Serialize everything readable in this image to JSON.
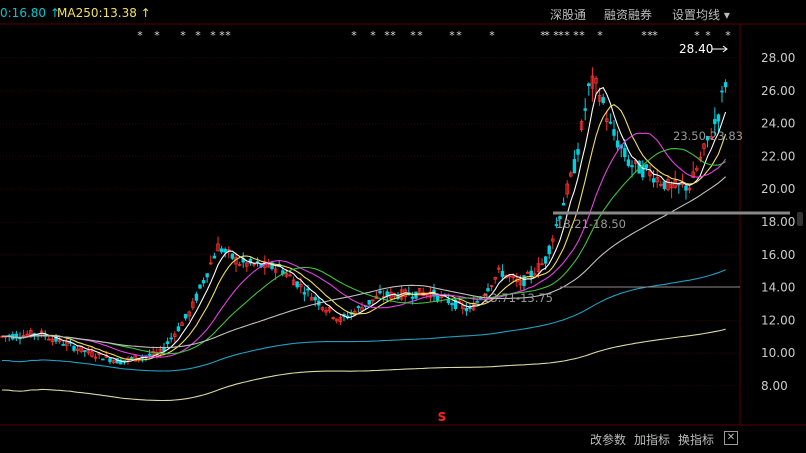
{
  "header": {
    "ma_left": "0:16.80 ↑",
    "ma_right": "MA250:13.38 ↑",
    "toolbar": [
      "深股通",
      "融资融券",
      "设置均线 ▾"
    ]
  },
  "footer": {
    "buttons": [
      "改参数",
      "加指标",
      "换指标"
    ],
    "close": "✕"
  },
  "chart_data": {
    "type": "candlestick",
    "y_axis_ticks": [
      "28.00",
      "26.00",
      "24.00",
      "22.00",
      "20.00",
      "18.00",
      "16.00",
      "14.00",
      "12.00",
      "10.00",
      "8.00"
    ],
    "ylim": [
      7.0,
      29.8
    ],
    "last_price": "28.40",
    "annotations": [
      "23.50-23.83",
      "18.21-18.50",
      "13.71-13.75"
    ],
    "bottom_marker": "S",
    "star_markers_x": [
      140,
      157,
      183,
      198,
      213,
      222,
      228,
      354,
      373,
      387,
      393,
      413,
      420,
      452,
      459,
      492,
      543,
      547,
      556,
      561,
      567,
      576,
      582,
      600,
      644,
      650,
      655,
      697,
      708,
      728
    ],
    "ma_colors": [
      "#ffffff",
      "#f0e060",
      "#e040e0",
      "#40c040",
      "#c0c0c0",
      "#20a0c0",
      "#d8d8a0"
    ],
    "up_color": "#ff3030",
    "down_color": "#00d0e0",
    "gridline_color": "#3a0000"
  }
}
